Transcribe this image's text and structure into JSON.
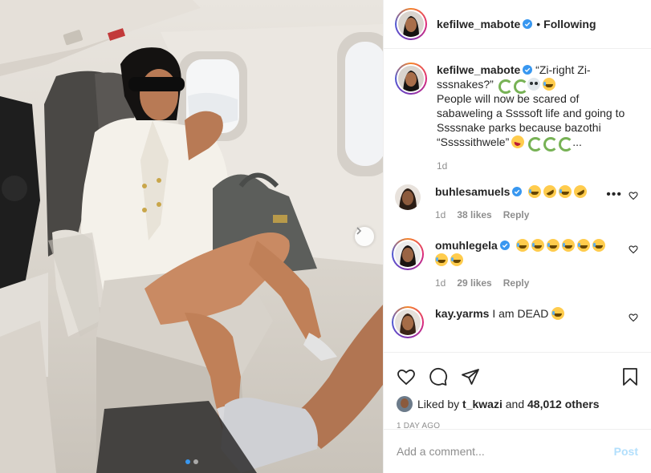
{
  "post": {
    "author": "kefilwe_mabote",
    "follow_separator": "•",
    "follow_status": "Following"
  },
  "caption": {
    "username": "kefilwe_mabote",
    "line1": "“Zi-right Zi-sssnakes?”",
    "line1_emojis": [
      "snake-emoji",
      "snake-emoji",
      "skull-emoji",
      "laugh-emoji"
    ],
    "text": "People will now be scared of sabaweling a Ssssoft life and going to Ssssnake parks because bazothi “Sssssithwele”",
    "trailing_emojis": [
      "zany-face-emoji",
      "snake-emoji",
      "snake-emoji",
      "snake-emoji"
    ],
    "trailing_text": "...",
    "age": "1d"
  },
  "comments": [
    {
      "username": "buhlesamuels",
      "text": "",
      "emojis": [
        "laugh-emoji",
        "rofl-emoji",
        "laugh-emoji",
        "rofl-emoji"
      ],
      "age": "1d",
      "likes": "38 likes",
      "reply": "Reply",
      "more": "•••"
    },
    {
      "username": "omuhlegela",
      "text": "",
      "emojis": [
        "laugh-emoji",
        "laugh-emoji",
        "laugh-emoji",
        "laugh-emoji",
        "laugh-emoji",
        "laugh-emoji",
        "laugh-emoji",
        "laugh-emoji"
      ],
      "age": "1d",
      "likes": "29 likes",
      "reply": "Reply"
    },
    {
      "username": "kay.yarms",
      "text": "I am DEAD",
      "emojis": [
        "laugh-emoji"
      ]
    }
  ],
  "likes": {
    "prefix": "Liked by",
    "user": "t_kwazi",
    "joiner": "and",
    "others": "48,012 others"
  },
  "timestamp": "1 DAY AGO",
  "add_comment": {
    "placeholder": "Add a comment...",
    "post_label": "Post"
  },
  "carousel": {
    "current_index": 1,
    "total": 2
  },
  "colors": {
    "accent": "#3897f0",
    "verified": "#3897f0",
    "post_disabled": "#b2dffc",
    "muted": "#8e8e8e"
  }
}
